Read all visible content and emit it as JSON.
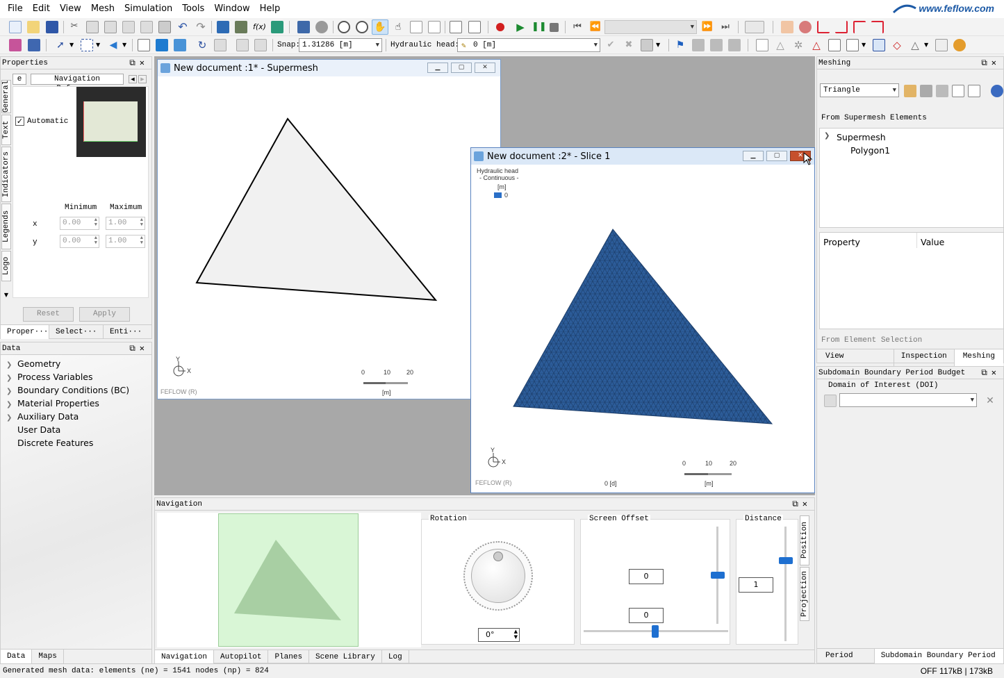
{
  "menu": [
    "File",
    "Edit",
    "View",
    "Mesh",
    "Simulation",
    "Tools",
    "Window",
    "Help"
  ],
  "brand": {
    "logo_text": "www.feflow.com",
    "color": "#1d5aa6"
  },
  "toolbar": {
    "snap_label": "Snap:",
    "snap_value": "1.31286 [m]",
    "hydraulic_label": "Hydraulic head:",
    "hydraulic_value": "0 [m]"
  },
  "properties": {
    "title": "Properties",
    "tab_partial": "e",
    "tab_active": "Navigation Reference",
    "side_tabs": [
      "General",
      "Text",
      "Indicators",
      "Legends",
      "Logo"
    ],
    "automatic_label": "Automatic",
    "col_min": "Minimum",
    "col_max": "Maximum",
    "x_label": "x",
    "y_label": "y",
    "x_min": "0.00",
    "x_max": "1.00",
    "y_min": "0.00",
    "y_max": "1.00",
    "reset": "Reset",
    "apply": "Apply",
    "bottom_tabs": [
      "Proper···",
      "Select···",
      "Enti···"
    ]
  },
  "data_panel": {
    "title": "Data",
    "items": [
      {
        "label": "Geometry",
        "expandable": true
      },
      {
        "label": "Process Variables",
        "expandable": true
      },
      {
        "label": "Boundary Conditions (BC)",
        "expandable": true
      },
      {
        "label": "Material Properties",
        "expandable": true
      },
      {
        "label": "Auxiliary Data",
        "expandable": true
      },
      {
        "label": "User Data",
        "expandable": false
      },
      {
        "label": "Discrete Features",
        "expandable": false
      }
    ],
    "bottom_tabs": [
      "Data",
      "Maps"
    ]
  },
  "doc1": {
    "title": "New document :1* - Supermesh",
    "axis_y": "Y",
    "axis_x": "X",
    "watermark": "FEFLOW (R)",
    "scale": [
      "0",
      "10",
      "20"
    ],
    "unit": "[m]"
  },
  "doc2": {
    "title": "New document :2* - Slice 1",
    "legend_title": "Hydraulic head",
    "legend_sub": "- Continuous -",
    "legend_unit": "[m]",
    "legend_value": "0",
    "mesh_color": "#2c5c99",
    "axis_y": "Y",
    "axis_x": "X",
    "watermark": "FEFLOW (R)",
    "time": "0 [d]",
    "scale": [
      "0",
      "10",
      "20"
    ],
    "unit": "[m]"
  },
  "navigation": {
    "title": "Navigation",
    "rotation_label": "Rotation",
    "rotation_value": "0°",
    "offset_label": "Screen Offset",
    "offset_x": "0",
    "offset_y": "0",
    "distance_label": "Distance",
    "distance_value": "1",
    "side_tabs": [
      "Position",
      "Projection"
    ],
    "bottom_tabs": [
      "Navigation",
      "Autopilot",
      "Planes",
      "Scene Library",
      "Log"
    ]
  },
  "meshing": {
    "title": "Meshing",
    "algorithm": "Triangle",
    "from_supermesh": "From Supermesh Elements",
    "tree_root": "Supermesh",
    "tree_child": "Polygon1",
    "prop_col": "Property",
    "value_col": "Value",
    "from_selection": "From Element Selection",
    "tabs": [
      "View Components",
      "Inspection",
      "Meshing"
    ]
  },
  "budget": {
    "title": "Subdomain Boundary Period Budget",
    "doi_label": "Domain of Interest (DOI)",
    "bottom_tabs": [
      "Period ···",
      "Subdomain Boundary Period ···"
    ]
  },
  "status": {
    "message": "Generated mesh data: elements (ne) = 1541  nodes (np) = 824",
    "right": "OFF  117kB | 173kB"
  }
}
